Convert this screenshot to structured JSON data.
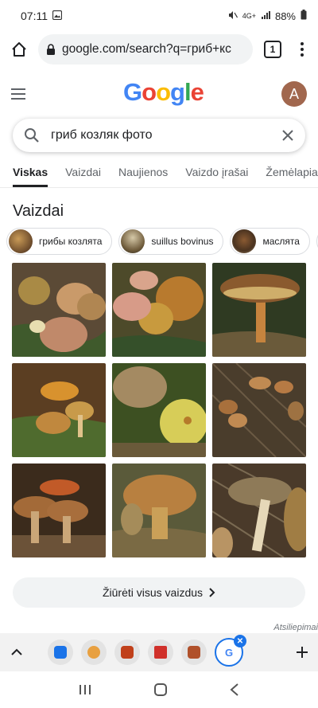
{
  "status": {
    "time": "07:11",
    "signal": "4G+",
    "battery": "88%"
  },
  "browser": {
    "url": "google.com/search?q=гриб+кс",
    "tab_count": "1"
  },
  "google": {
    "logo": "Google",
    "avatar_letter": "A"
  },
  "search": {
    "query": "гриб козляк фото"
  },
  "tabs": [
    {
      "label": "Viskas"
    },
    {
      "label": "Vaizdai"
    },
    {
      "label": "Naujienos"
    },
    {
      "label": "Vaizdo įrašai"
    },
    {
      "label": "Žemėlapia"
    }
  ],
  "images_section": {
    "title": "Vaizdai",
    "chips": [
      {
        "label": "грибы козлята"
      },
      {
        "label": "suillus bovinus"
      },
      {
        "label": "маслята"
      }
    ],
    "view_all": "Žiūrėti visus vaizdus"
  },
  "feedback": "Atsiliepimai",
  "colors": {
    "accent": "#1a73e8",
    "avatar": "#a1674e"
  }
}
